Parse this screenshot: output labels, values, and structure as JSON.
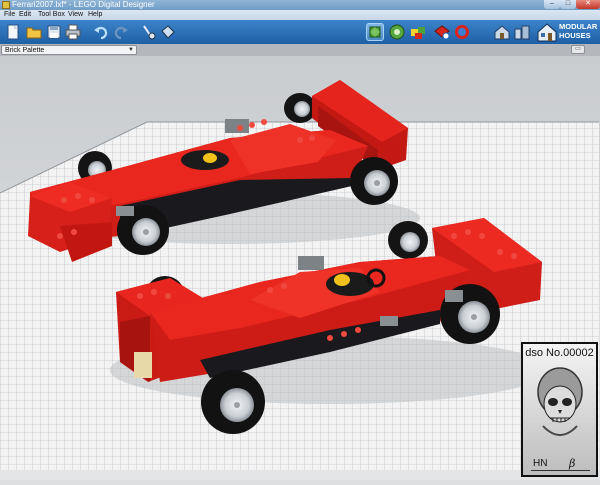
{
  "window": {
    "title": "Ferrari2007.lxf* - LEGO Digital Designer"
  },
  "menu": [
    "File",
    "Edit",
    "Tool Box",
    "View",
    "Help"
  ],
  "toolbar": {
    "left_icons": [
      "new-file-icon",
      "open-folder-icon",
      "save-icon",
      "print-icon",
      "undo-icon",
      "redo-icon",
      "clone-tool-icon",
      "paint-bucket-icon"
    ],
    "mode_icons": [
      "build-mode-icon",
      "view-mode-icon",
      "building-guide-icon",
      "add-model-icon",
      "share-icon"
    ],
    "theme_icons": [
      "house-theme-icon",
      "city-theme-icon"
    ],
    "theme_label_line1": "MODULAR",
    "theme_label_line2": "HOUSES",
    "theme_icon": "modular-houses-icon"
  },
  "palette": {
    "label": "Brick Palette",
    "toggle_icon": "palette-toggle-icon"
  },
  "badge": {
    "number": "dso No.00002",
    "initials": "HN",
    "beta": "β",
    "emblem": "skull-emblem"
  },
  "colors": {
    "brick_red": "#e0231c",
    "toolbar_blue": "#2a6fb8",
    "grid_base": "#f2f2f2"
  }
}
